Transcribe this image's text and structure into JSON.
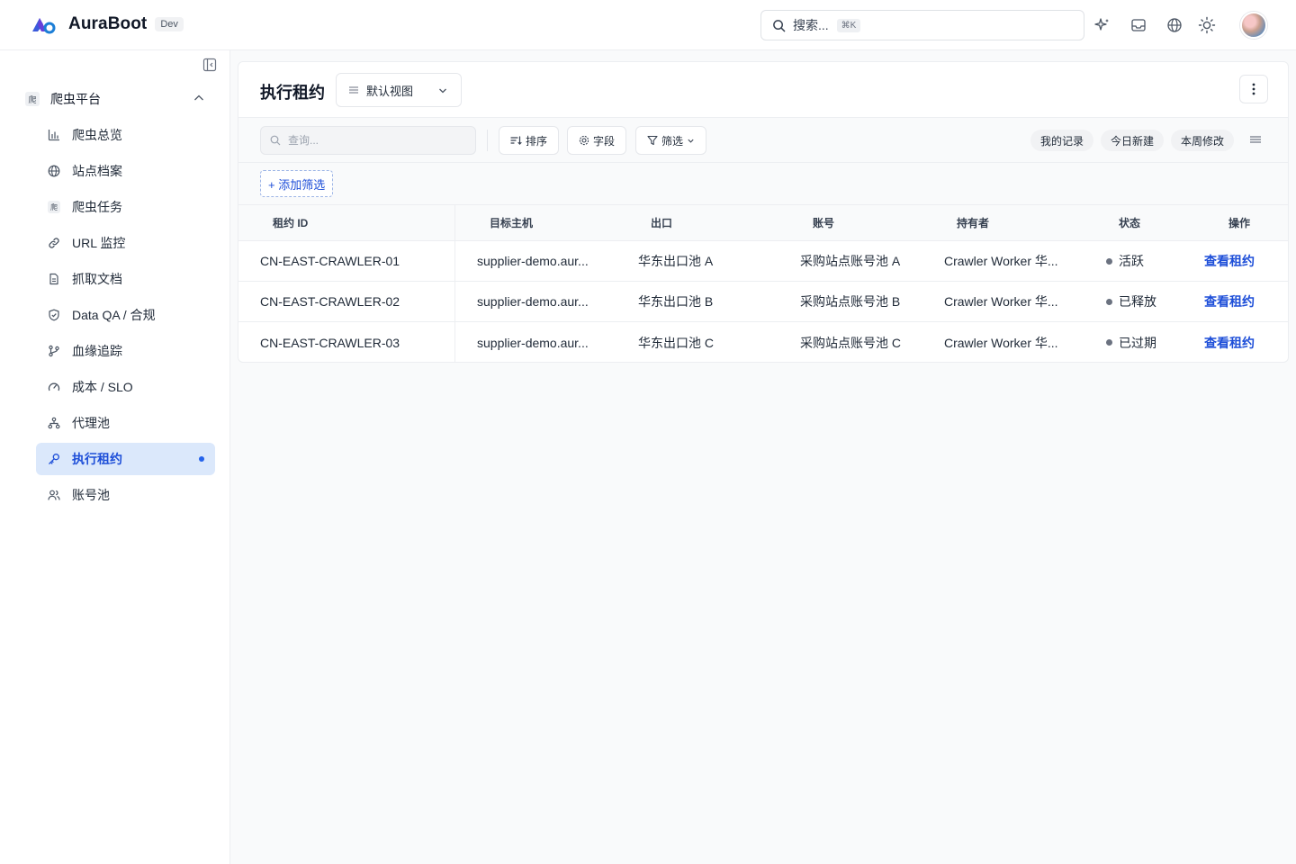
{
  "brand": {
    "name": "AuraBoot",
    "env": "Dev"
  },
  "header": {
    "search_label": "搜索...",
    "search_kbd": "⌘K"
  },
  "sidebar": {
    "group": {
      "badge": "爬",
      "label": "爬虫平台"
    },
    "items": [
      {
        "icon": "chart-bar-icon",
        "label": "爬虫总览"
      },
      {
        "icon": "globe-icon",
        "label": "站点档案"
      },
      {
        "icon": "crawler-badge-icon",
        "badge": "爬",
        "label": "爬虫任务"
      },
      {
        "icon": "link-icon",
        "label": "URL 监控"
      },
      {
        "icon": "document-icon",
        "label": "抓取文档"
      },
      {
        "icon": "shield-check-icon",
        "label": "Data QA / 合规"
      },
      {
        "icon": "git-branch-icon",
        "label": "血缘追踪"
      },
      {
        "icon": "gauge-icon",
        "label": "成本 / SLO"
      },
      {
        "icon": "network-icon",
        "label": "代理池"
      },
      {
        "icon": "key-icon",
        "label": "执行租约",
        "active": true
      },
      {
        "icon": "users-icon",
        "label": "账号池"
      }
    ]
  },
  "page": {
    "title": "执行租约",
    "view_label": "默认视图"
  },
  "toolbar": {
    "query_placeholder": "查询...",
    "sort_label": "排序",
    "fields_label": "字段",
    "filter_label": "筛选",
    "quick_filters": [
      "我的记录",
      "今日新建",
      "本周修改"
    ],
    "add_filter_label": "+ 添加筛选"
  },
  "table": {
    "columns": [
      "租约 ID",
      "目标主机",
      "出口",
      "账号",
      "持有者",
      "状态",
      "操作"
    ],
    "rows": [
      {
        "id": "CN-EAST-CRAWLER-01",
        "host": "supplier-demo.aur...",
        "egress": "华东出口池 A",
        "account": "采购站点账号池 A",
        "holder": "Crawler Worker 华...",
        "status": "活跃",
        "action": "查看租约"
      },
      {
        "id": "CN-EAST-CRAWLER-02",
        "host": "supplier-demo.aur...",
        "egress": "华东出口池 B",
        "account": "采购站点账号池 B",
        "holder": "Crawler Worker 华...",
        "status": "已释放",
        "action": "查看租约"
      },
      {
        "id": "CN-EAST-CRAWLER-03",
        "host": "supplier-demo.aur...",
        "egress": "华东出口池 C",
        "account": "采购站点账号池 C",
        "holder": "Crawler Worker 华...",
        "status": "已过期",
        "action": "查看租约"
      }
    ]
  },
  "colors": {
    "accent": "#1d4ed8",
    "active_bg": "#dbe8fb",
    "status_dot": "#6b7280"
  }
}
